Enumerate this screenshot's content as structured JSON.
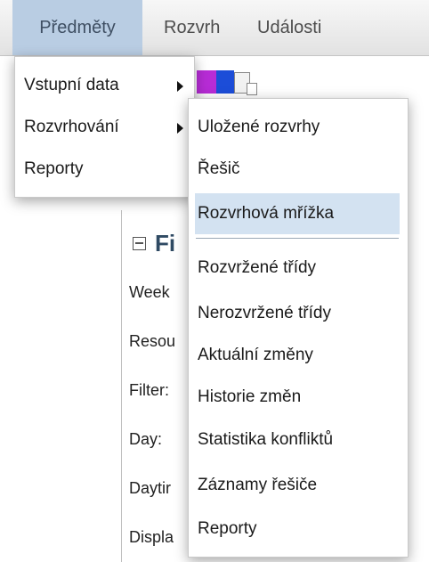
{
  "menubar": {
    "items": [
      "Předměty",
      "Rozvrh",
      "Události"
    ]
  },
  "filter_panel": {
    "title": "Fi",
    "labels": [
      "Week",
      "Resou",
      "Filter:",
      "Day:",
      "Daytir",
      "Displa"
    ]
  },
  "menu1": {
    "items": [
      "Vstupní data",
      "Rozvrhování",
      "Reporty"
    ]
  },
  "menu2": {
    "items": [
      "Uložené rozvrhy",
      "Řešič",
      "Rozvrhová mřížka",
      "Rozvržené třídy",
      "Nerozvržené třídy",
      "Aktuální změny",
      "Historie změn",
      "Statistika konfliktů",
      "Záznamy řešiče",
      "Reporty"
    ]
  },
  "colors": {
    "menubar_active_bg": "#b9cde3",
    "menu_highlight_bg": "#d3e2f1",
    "filter_title": "#2f4a63"
  },
  "icons": {
    "collapse": "collapse-minus-icon",
    "submenu": "chevron-right-icon"
  }
}
